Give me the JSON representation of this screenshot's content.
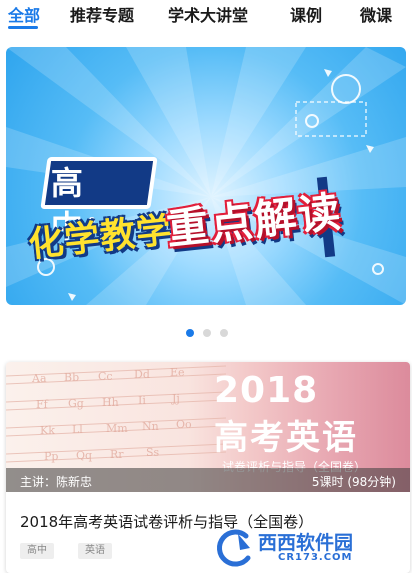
{
  "tabs": [
    {
      "label": "全部",
      "active": true
    },
    {
      "label": "推荐专题",
      "active": false
    },
    {
      "label": "学术大讲堂",
      "active": false
    },
    {
      "label": "课例",
      "active": false
    },
    {
      "label": "微课",
      "active": false
    }
  ],
  "banner": {
    "line1": "高中：",
    "line2": "化学教学",
    "line3": "重点解读"
  },
  "carousel": {
    "count": 3,
    "active_index": 0
  },
  "course": {
    "cover_year": "2018",
    "cover_title": "高考英语",
    "cover_subtitle": "试卷评析与指导（全国卷）",
    "lecturer": "主讲：陈新忠",
    "duration": "5课时 (98分钟)",
    "title": "2018年高考英语试卷评析与指导（全国卷）",
    "tags": [
      "高中",
      "英语"
    ]
  },
  "watermark": {
    "main": "西西软件园",
    "sub": "CR173.COM"
  },
  "colors": {
    "accent": "#1a7ae8",
    "banner_yellow": "#ffe22e",
    "banner_red": "#e21f3b",
    "banner_navy": "#123a86"
  }
}
